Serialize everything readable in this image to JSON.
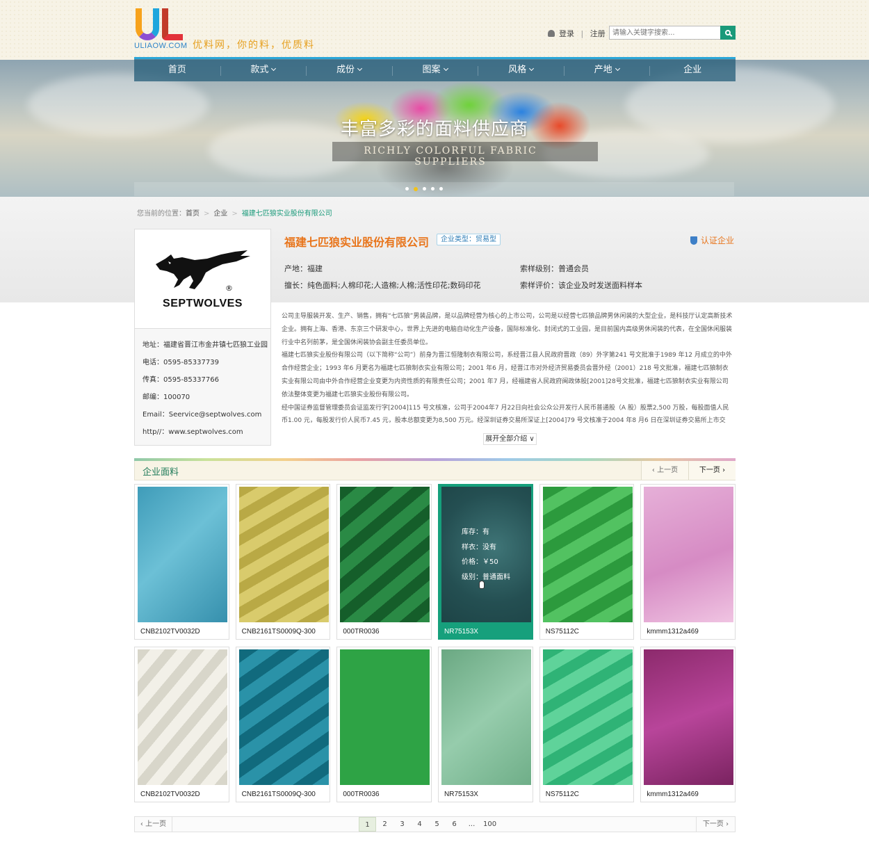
{
  "header": {
    "site_domain": "ULIAOW.COM",
    "slogan": "优料网，你的料，优质料",
    "login": "登录",
    "register": "注册",
    "search_placeholder": "请输入关键字搜索..."
  },
  "nav": {
    "items": [
      {
        "label": "首页",
        "dropdown": false
      },
      {
        "label": "款式",
        "dropdown": true
      },
      {
        "label": "成份",
        "dropdown": true
      },
      {
        "label": "图案",
        "dropdown": true
      },
      {
        "label": "风格",
        "dropdown": true
      },
      {
        "label": "产地",
        "dropdown": true
      },
      {
        "label": "企业",
        "dropdown": false
      }
    ]
  },
  "banner": {
    "title": "丰富多彩的面料供应商",
    "subtitle": "RICHLY COLORFUL FABRIC SUPPLIERS",
    "slides": 5,
    "active_slide": 2
  },
  "breadcrumb": {
    "prefix": "您当前的位置：",
    "home": "首页",
    "level1": "企业",
    "current": "福建七匹狼实业股份有限公司"
  },
  "company": {
    "brand": "SEPTWOLVES",
    "reg_mark": "®",
    "name": "福建七匹狼实业股份有限公司",
    "type_tag": "企业类型：贸易型",
    "verified": "认证企业",
    "origin_label": "产地：",
    "origin": "福建",
    "specialty_label": "擅长：",
    "specialty": "纯色面料;人棉印花;人造棉;人棉;活性印花;数码印花",
    "sample_level_label": "索样级别：",
    "sample_level": "普通会员",
    "sample_rating_label": "索样评价：",
    "sample_rating": "该企业及时发送面料样本",
    "address": "地址：福建省晋江市金井镇七匹狼工业园",
    "phone": "电话：0595-85337739",
    "fax": "传真：0595-85337766",
    "postcode": "邮编：100070",
    "email": "Email：Seervice@septwolves.com",
    "website": "http//：www.septwolves.com",
    "description": [
      "公司主导服装开发、生产、销售，拥有“七匹狼”男装品牌，是以品牌经营为核心的上市公司，公司是以经营七匹狼品牌男休闲装的大型企业，是科技厅认定高新技术企业。拥有上海、香港、东京三个研发中心，世界上先进的电脑自动化生产设备，国际标准化、封闭式的工业园，是目前国内高级男休闲装的代表，在全国休闲服装行业中名列前茅，是全国休闲装协会副主任委员单位。",
      "福建七匹狼实业股份有限公司（以下简称“公司”）前身为晋江恒隆制衣有限公司，系经晋江县人民政府晋政（89）外字第241 号文批准于1989 年12 月成立的中外合作经营企业；1993 年6 月更名为福建七匹狼制衣实业有限公司；2001 年6 月，经晋江市对外经济贸易委员会晋外经（2001）218 号文批准，福建七匹狼制衣实业有限公司由中外合作经营企业变更为内资性质的有限责任公司；2001 年7 月，经福建省人民政府闽政体股[2001]28号文批准，福建七匹狼制衣实业有限公司依法整体变更为福建七匹狼实业股份有限公司。",
      "经中国证券监督管理委员会证监发行字[2004]115 号文核准，公司于2004年7 月22日向社会公众公开发行人民币普通股（A 股）股票2,500 万股，每股面值人民币1.00 元，每股发行价人民币7.45 元，股本总额变更为8,500 万元。经深圳证券交易所深证上[2004]79 号文核准于2004 年8 月6 日在深圳证券交易所上市交易，证券简称为“七匹狼”，证"
    ],
    "expand": "展开全部介绍"
  },
  "fabrics": {
    "title": "企业面料",
    "prev": "上一页",
    "next": "下一页",
    "overlay": {
      "stock": "库存：有",
      "sample": "样衣：没有",
      "price": "价格：￥50",
      "level": "级别：普通面料"
    },
    "row1": [
      {
        "code": "CNB2102TV0032D",
        "color": "#4aa7c4"
      },
      {
        "code": "CNB2161TS0009Q-300",
        "color": "#c9bb56"
      },
      {
        "code": "000TR0036",
        "color": "#1d7a35"
      },
      {
        "code": "NR75153X",
        "color": "#2a5a5c"
      },
      {
        "code": "NS75112C",
        "color": "#36a447"
      },
      {
        "code": "kmmm1312a469",
        "color": "#dea0cf"
      }
    ],
    "row2": [
      {
        "code": "CNB2102TV0032D",
        "color": "#e4e2d8"
      },
      {
        "code": "CNB2161TS0009Q-300",
        "color": "#1d7f92"
      },
      {
        "code": "000TR0036",
        "color": "#2ea345"
      },
      {
        "code": "NR75153X",
        "color": "#7cb892"
      },
      {
        "code": "NS75112C",
        "color": "#3ec286"
      },
      {
        "code": "kmmm1312a469",
        "color": "#a2357f"
      }
    ]
  },
  "pagination": {
    "prev": "上一页",
    "next": "下一页",
    "pages": [
      "1",
      "2",
      "3",
      "4",
      "5",
      "6",
      "...",
      "100"
    ],
    "current": "1"
  }
}
